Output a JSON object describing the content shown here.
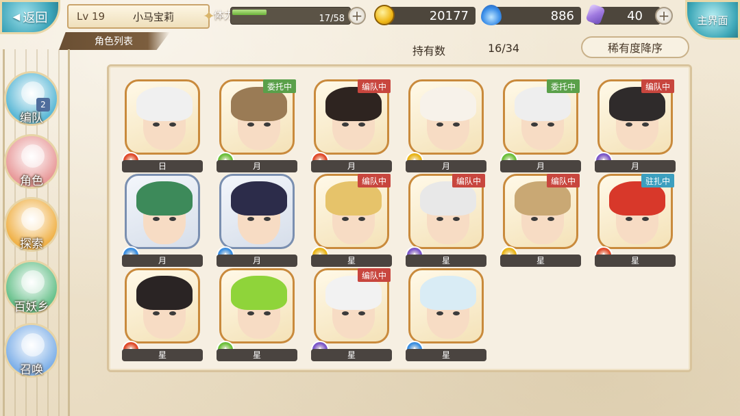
{
  "header": {
    "back_label": "返回",
    "level": "Lv 19",
    "player_name": "小马宝莉",
    "stamina_label": "体力",
    "stamina_text": "17/58",
    "stamina_fraction": 0.293,
    "gold": "20177",
    "spirit": "886",
    "gems": "40",
    "home_label": "主界面"
  },
  "subtitle": "角色列表",
  "owned_label": "持有数",
  "owned_value": "16/34",
  "sort_label": "稀有度降序",
  "nav": [
    {
      "label": "编队",
      "icon": "team-icon",
      "badge": "2",
      "color": "#5bb8d6"
    },
    {
      "label": "角色",
      "icon": "character-icon",
      "color": "#e89a9a"
    },
    {
      "label": "探索",
      "icon": "explore-icon",
      "color": "#f0b24a"
    },
    {
      "label": "百妖乡",
      "icon": "village-icon",
      "color": "#66c08a"
    },
    {
      "label": "召唤",
      "icon": "summon-icon",
      "color": "#7fb0e8"
    }
  ],
  "attr_colors": {
    "fire": "#e04a2a",
    "wind": "#6bbf3a",
    "water": "#3a8ee0",
    "light": "#e8b418",
    "dark": "#7a55c8"
  },
  "tag_colors": {
    "委托中": "#5aa04a",
    "编队中": "#c8463e",
    "驻扎中": "#3c9fbf"
  },
  "characters": [
    {
      "grade": "日",
      "attr": "fire",
      "tag": "",
      "hair": "#f0f0f0",
      "cool": false
    },
    {
      "grade": "月",
      "attr": "wind",
      "tag": "委托中",
      "hair": "#9a7b55",
      "cool": false
    },
    {
      "grade": "月",
      "attr": "fire",
      "tag": "编队中",
      "hair": "#2e2420",
      "cool": false
    },
    {
      "grade": "月",
      "attr": "light",
      "tag": "",
      "hair": "#f7f2ea",
      "cool": false
    },
    {
      "grade": "月",
      "attr": "wind",
      "tag": "委托中",
      "hair": "#eeeeee",
      "cool": false
    },
    {
      "grade": "月",
      "attr": "dark",
      "tag": "编队中",
      "hair": "#2f2b2b",
      "cool": false
    },
    {
      "grade": "月",
      "attr": "water",
      "tag": "",
      "hair": "#3d8a5a",
      "cool": true
    },
    {
      "grade": "月",
      "attr": "water",
      "tag": "",
      "hair": "#2c2c4a",
      "cool": true
    },
    {
      "grade": "星",
      "attr": "light",
      "tag": "编队中",
      "hair": "#e6c36a",
      "cool": false
    },
    {
      "grade": "星",
      "attr": "dark",
      "tag": "编队中",
      "hair": "#e8e8e8",
      "cool": false
    },
    {
      "grade": "星",
      "attr": "light",
      "tag": "编队中",
      "hair": "#c9a874",
      "cool": false
    },
    {
      "grade": "星",
      "attr": "fire",
      "tag": "驻扎中",
      "hair": "#d8382a",
      "cool": false
    },
    {
      "grade": "星",
      "attr": "fire",
      "tag": "",
      "hair": "#2a2424",
      "cool": false
    },
    {
      "grade": "星",
      "attr": "wind",
      "tag": "",
      "hair": "#8fd43a",
      "cool": false
    },
    {
      "grade": "星",
      "attr": "dark",
      "tag": "编队中",
      "hair": "#f2f2f2",
      "cool": false
    },
    {
      "grade": "星",
      "attr": "water",
      "tag": "",
      "hair": "#d9ecf5",
      "cool": false
    }
  ]
}
